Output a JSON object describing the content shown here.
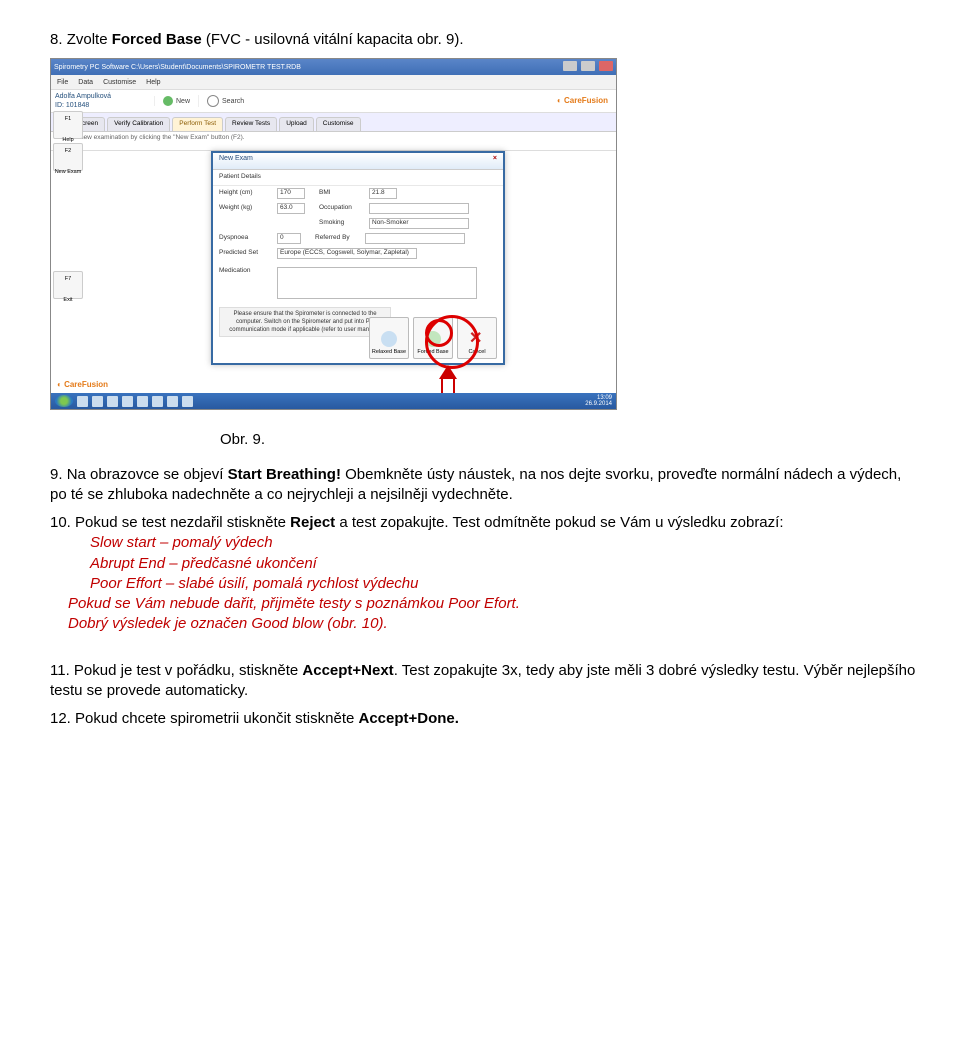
{
  "step8": {
    "num": "8.",
    "prefix": "Zvolte ",
    "bold": "Forced Base",
    "suffix": " (FVC - usilovná vitální kapacita obr. 9)."
  },
  "screenshot": {
    "titlebar": "Spirometry PC Software   C:\\Users\\Student\\Documents\\SPIROMETR TEST.RDB",
    "menu": [
      "File",
      "Data",
      "Customise",
      "Help"
    ],
    "patient_name": "Adolfa Ampulková",
    "patient_id": "ID: 101848",
    "tool_new": "New",
    "tool_search": "Search",
    "brand": "CareFusion",
    "tabs": [
      "Start Screen",
      "Verify Calibration",
      "Perform Test",
      "Review Tests",
      "Upload",
      "Customise"
    ],
    "active_tab_idx": 2,
    "hint": "Start a new examination by clicking the \"New Exam\" button (F2).",
    "left_buttons": [
      {
        "key": "F1",
        "label": "Help"
      },
      {
        "key": "F2",
        "label": "New Exam"
      },
      {
        "key": "F7",
        "label": "Exit"
      }
    ],
    "dialog": {
      "title": "New Exam",
      "subtitle": "Patient Details",
      "fields": {
        "height_lbl": "Height (cm)",
        "height_val": "170",
        "bmi_lbl": "BMI",
        "bmi_val": "21.8",
        "weight_lbl": "Weight (kg)",
        "weight_val": "63.0",
        "occupation_lbl": "Occupation",
        "smoking_lbl": "Smoking",
        "smoking_val": "Non-Smoker",
        "dyspnoea_lbl": "Dyspnoea",
        "dyspnoea_val": "0",
        "referred_lbl": "Referred By",
        "predicted_lbl": "Predicted Set",
        "predicted_val": "Europe (ECCS, Cogswell, Solymar, Zapletal)",
        "medication_lbl": "Medication"
      },
      "message": "Please ensure that the Spirometer is connected to the computer.\nSwitch on the Spirometer and put into PC communication mode if applicable (refer to user manual).",
      "btn_relaxed": "Relaxed Base",
      "btn_forced": "Forced Base",
      "btn_cancel": "Cancel"
    },
    "taskbar_time": "13:09",
    "taskbar_date": "26.9.2014"
  },
  "caption": "Obr. 9.",
  "step9": {
    "num": "9.",
    "line1_a": "Na obrazovce se objeví ",
    "line1_b": "Start Breathing!",
    "line1_c": " Obemkněte ústy náustek, na nos dejte svorku, proveďte normální nádech a výdech, po té se zhluboka  nadechněte a co nejrychleji a nejsilněji vydechněte."
  },
  "step10": {
    "num": "10.",
    "t1": "Pokud se test nezdařil stiskněte  ",
    "t1b": "Reject",
    "t1c": " a test zopakujte. Test odmítněte pokud se Vám u výsledku zobrazí:",
    "bul1": "Slow start – pomalý výdech",
    "bul2": "Abrupt End – předčasné ukončení",
    "bul3": "Poor Effort – slabé úsilí, pomalá rychlost výdechu",
    "t2": "Pokud se Vám nebude dařit, přijměte testy s poznámkou Poor Efort.",
    "t3": "Dobrý výsledek je označen Good blow (obr. 10)."
  },
  "step11": {
    "num": "11.",
    "t1": "Pokud je test v pořádku, stiskněte ",
    "t1b": "Accept+Next",
    "t1c": ". Test zopakujte 3x, tedy aby  jste měli 3 dobré výsledky testu.  Výběr nejlepšího testu se provede automaticky."
  },
  "step12": {
    "num": "12.",
    "t1": "Pokud chcete spirometrii ukončit stiskněte  ",
    "t1b": "Accept+Done."
  }
}
